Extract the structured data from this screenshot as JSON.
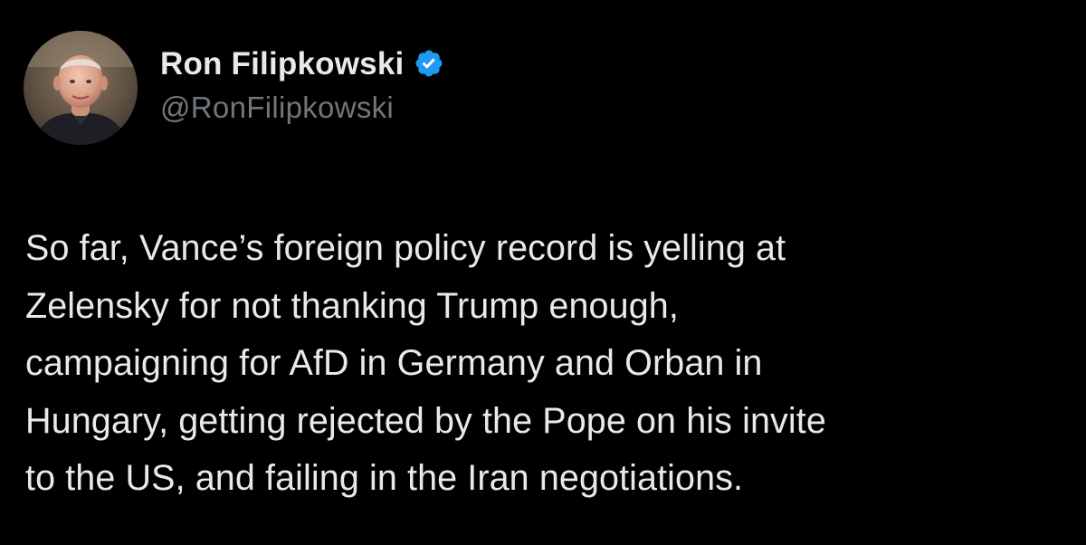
{
  "post": {
    "author": {
      "display_name": "Ron Filipkowski",
      "handle": "@RonFilipkowski",
      "verified": true,
      "avatar_icon": "profile-photo"
    },
    "text": "So far, Vance’s foreign policy record is yelling at\nZelensky for not thanking Trump enough,\ncampaigning for AfD in Germany and Orban in\nHungary, getting rejected by the Pope on his invite\nto the US, and failing in the Iran negotiations."
  },
  "colors": {
    "background": "#000000",
    "primary_text": "#e7e9ea",
    "secondary_text": "#71767b",
    "verified_badge": "#1d9bf0"
  }
}
